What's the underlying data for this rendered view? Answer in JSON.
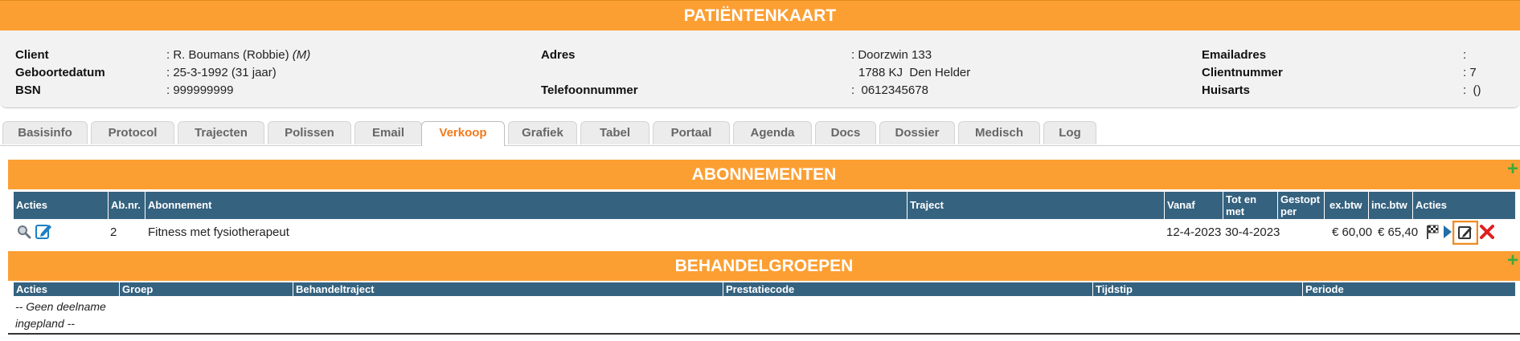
{
  "header": {
    "title": "PATIËNTENKAART"
  },
  "patient": {
    "client_label": "Client",
    "client_value": ": R. Boumans (Robbie) ",
    "client_gender": "(M)",
    "birthdate_label": "Geboortedatum",
    "birthdate_value": ": 25-3-1992 (31 jaar)",
    "bsn_label": "BSN",
    "bsn_value": ": 999999999",
    "address_label": "Adres",
    "address_line1": ": Doorzwin 133",
    "address_line2": "1788 KJ  Den Helder",
    "phone_label": "Telefoonnummer",
    "phone_value": ":  0612345678",
    "email_label": "Emailadres",
    "email_value": ":",
    "clientnr_label": "Clientnummer",
    "clientnr_value": ": 7",
    "gp_label": "Huisarts",
    "gp_value": ":  ()"
  },
  "tabs": [
    "Basisinfo",
    "Protocol",
    "Trajecten",
    "Polissen",
    "Email",
    "Verkoop",
    "Grafiek",
    "Tabel",
    "Portaal",
    "Agenda",
    "Docs",
    "Dossier",
    "Medisch",
    "Log"
  ],
  "active_tab": "Verkoop",
  "subscriptions": {
    "title": "ABONNEMENTEN",
    "add_symbol": "+",
    "columns": {
      "acties": "Acties",
      "abnr": "Ab.nr.",
      "abonnement": "Abonnement",
      "traject": "Traject",
      "vanaf": "Vanaf",
      "totenmet_1": "Tot en",
      "totenmet_2": "met",
      "gestopt_1": "Gestopt",
      "gestopt_2": "per",
      "exbtw": "ex.btw",
      "incbtw": "inc.btw",
      "acties2": "Acties"
    },
    "rows": [
      {
        "abnr": "2",
        "abonnement": "Fitness met fysiotherapeut",
        "traject": "",
        "vanaf": "12-4-2023",
        "totenmet": "30-4-2023",
        "gestopt": "",
        "exbtw": "€ 60,00",
        "incbtw": "€ 65,40"
      }
    ]
  },
  "groups": {
    "title": "BEHANDELGROEPEN",
    "add_symbol": "+",
    "columns": {
      "acties": "Acties",
      "groep": "Groep",
      "behandeltraject": "Behandeltraject",
      "prestatiecode": "Prestatiecode",
      "tijdstip": "Tijdstip",
      "periode": "Periode"
    },
    "empty_line1": "-- Geen deelname",
    "empty_line2": "ingepland --"
  },
  "icons": {
    "row_actions_left": [
      "magnifier-icon",
      "edit-icon"
    ],
    "row_actions_right": [
      "flag-icon",
      "play-icon",
      "edit-box-icon",
      "delete-icon"
    ]
  },
  "colors": {
    "orange": "#fc9f33",
    "table_header": "#35627f",
    "active_tab_text": "#f07a1c",
    "add_green": "#3aab3a",
    "delete_red": "#e02020"
  }
}
